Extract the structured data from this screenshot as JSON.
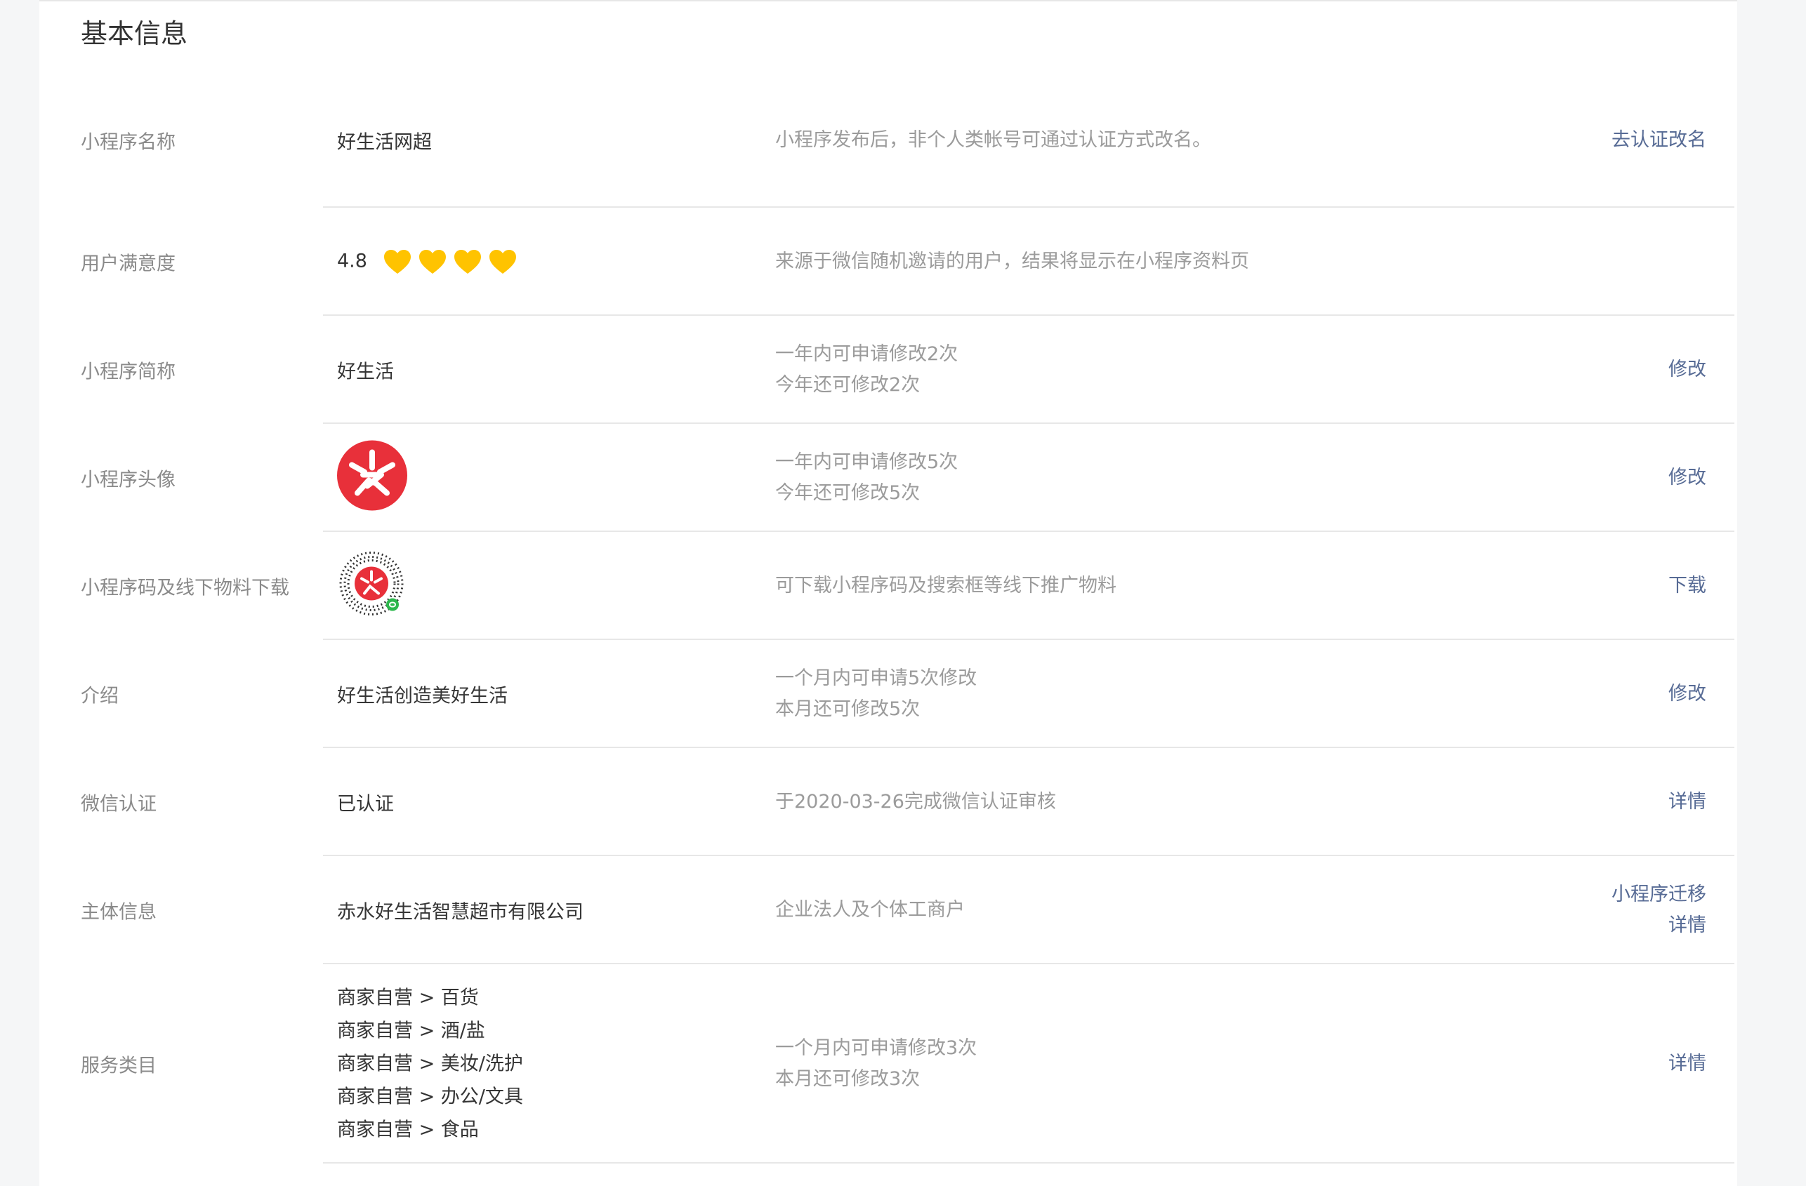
{
  "page": {
    "title": "基本信息"
  },
  "rows": [
    {
      "label": "小程序名称",
      "value": "好生活网超",
      "desc": [
        "小程序发布后，非个人类帐号可通过认证方式改名。"
      ],
      "actions": [
        "去认证改名"
      ]
    },
    {
      "label": "用户满意度",
      "value": "4.8",
      "hearts": 4,
      "desc": [
        "来源于微信随机邀请的用户，结果将显示在小程序资料页"
      ],
      "actions": []
    },
    {
      "label": "小程序简称",
      "value": "好生活",
      "desc": [
        "一年内可申请修改2次",
        "今年还可修改2次"
      ],
      "actions": [
        "修改"
      ]
    },
    {
      "label": "小程序头像",
      "value": "",
      "desc": [
        "一年内可申请修改5次",
        "今年还可修改5次"
      ],
      "actions": [
        "修改"
      ]
    },
    {
      "label": "小程序码及线下物料下载",
      "value": "",
      "desc": [
        "可下载小程序码及搜索框等线下推广物料"
      ],
      "actions": [
        "下载"
      ]
    },
    {
      "label": "介绍",
      "value": "好生活创造美好生活",
      "desc": [
        "一个月内可申请5次修改",
        "本月还可修改5次"
      ],
      "actions": [
        "修改"
      ]
    },
    {
      "label": "微信认证",
      "value": "已认证",
      "desc": [
        "于2020-03-26完成微信认证审核"
      ],
      "actions": [
        "详情"
      ]
    },
    {
      "label": "主体信息",
      "value": "赤水好生活智慧超市有限公司",
      "desc": [
        "企业法人及个体工商户"
      ],
      "actions": [
        "小程序迁移",
        "详情"
      ]
    },
    {
      "label": "服务类目",
      "values": [
        "商家自营 > 百货",
        "商家自营 > 酒/盐",
        "商家自营 > 美妆/洗护",
        "商家自营 > 办公/文具",
        "商家自营 > 食品"
      ],
      "desc": [
        "一个月内可申请修改3次",
        "本月还可修改3次"
      ],
      "actions": [
        "详情"
      ]
    }
  ],
  "colors": {
    "link": "#576b95",
    "heart": "#ffc300",
    "avatar_red": "#e8303a"
  },
  "icons": {
    "heart": "heart-icon",
    "avatar": "app-avatar-icon",
    "qrcode": "mini-program-code-icon"
  }
}
